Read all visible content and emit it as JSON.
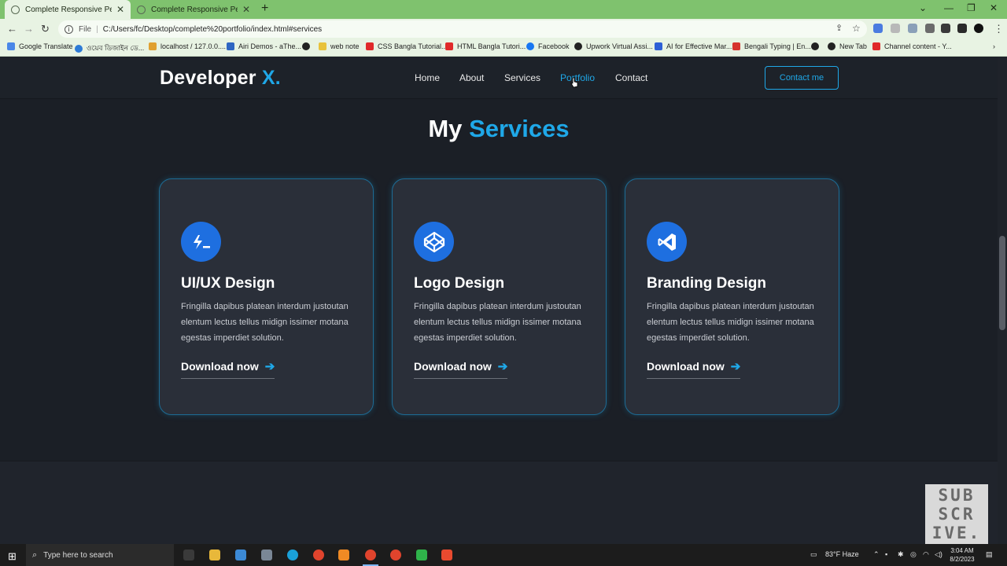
{
  "browser": {
    "tabs": [
      {
        "title": "Complete Responsive Personal P",
        "active": true
      },
      {
        "title": "Complete Responsive Personal P",
        "active": false
      }
    ],
    "address": {
      "scheme_label": "File",
      "url": "C:/Users/fc/Desktop/complete%20portfolio/index.html#services"
    },
    "bookmarks": [
      "Google Translate",
      "ওয়েব ডিজাইন ডে...",
      "localhost / 127.0.0....",
      "Airi Demos - aThe...",
      "web note",
      "CSS Bangla Tutorial...",
      "HTML Bangla Tutori...",
      "Facebook",
      "Upwork Virtual Assi...",
      "AI for Effective Mar...",
      "Bengali Typing | En...",
      "New Tab",
      "Channel content - Y..."
    ]
  },
  "site": {
    "logo": {
      "text": "Developer",
      "accent": "X."
    },
    "nav": [
      "Home",
      "About",
      "Services",
      "Portfolio",
      "Contact"
    ],
    "active_nav": "Portfolio",
    "contact_button": "Contact me"
  },
  "services": {
    "title_prefix": "My",
    "title_accent": "Services",
    "cards": [
      {
        "icon": "terminal-icon",
        "title": "UI/UX Design",
        "text": "Fringilla dapibus platean interdum justoutan elentum lectus tellus midign issimer motana egestas imperdiet solution.",
        "link": "Download now"
      },
      {
        "icon": "codepen-icon",
        "title": "Logo Design",
        "text": "Fringilla dapibus platean interdum justoutan elentum lectus tellus midign issimer motana egestas imperdiet solution.",
        "link": "Download now"
      },
      {
        "icon": "vscode-icon",
        "title": "Branding Design",
        "text": "Fringilla dapibus platean interdum justoutan elentum lectus tellus midign issimer motana egestas imperdiet solution.",
        "link": "Download now"
      }
    ]
  },
  "overlay": {
    "subscribe": [
      "SUB",
      "SCR",
      "IVE."
    ]
  },
  "taskbar": {
    "search_placeholder": "Type here to search",
    "weather": "83°F  Haze",
    "time": "3:04 AM",
    "date": "8/2/2023"
  },
  "colors": {
    "accent": "#1fa8e8",
    "background": "#1b1f26",
    "card": "#2a2f39",
    "icon_bg": "#1e6fe0"
  }
}
